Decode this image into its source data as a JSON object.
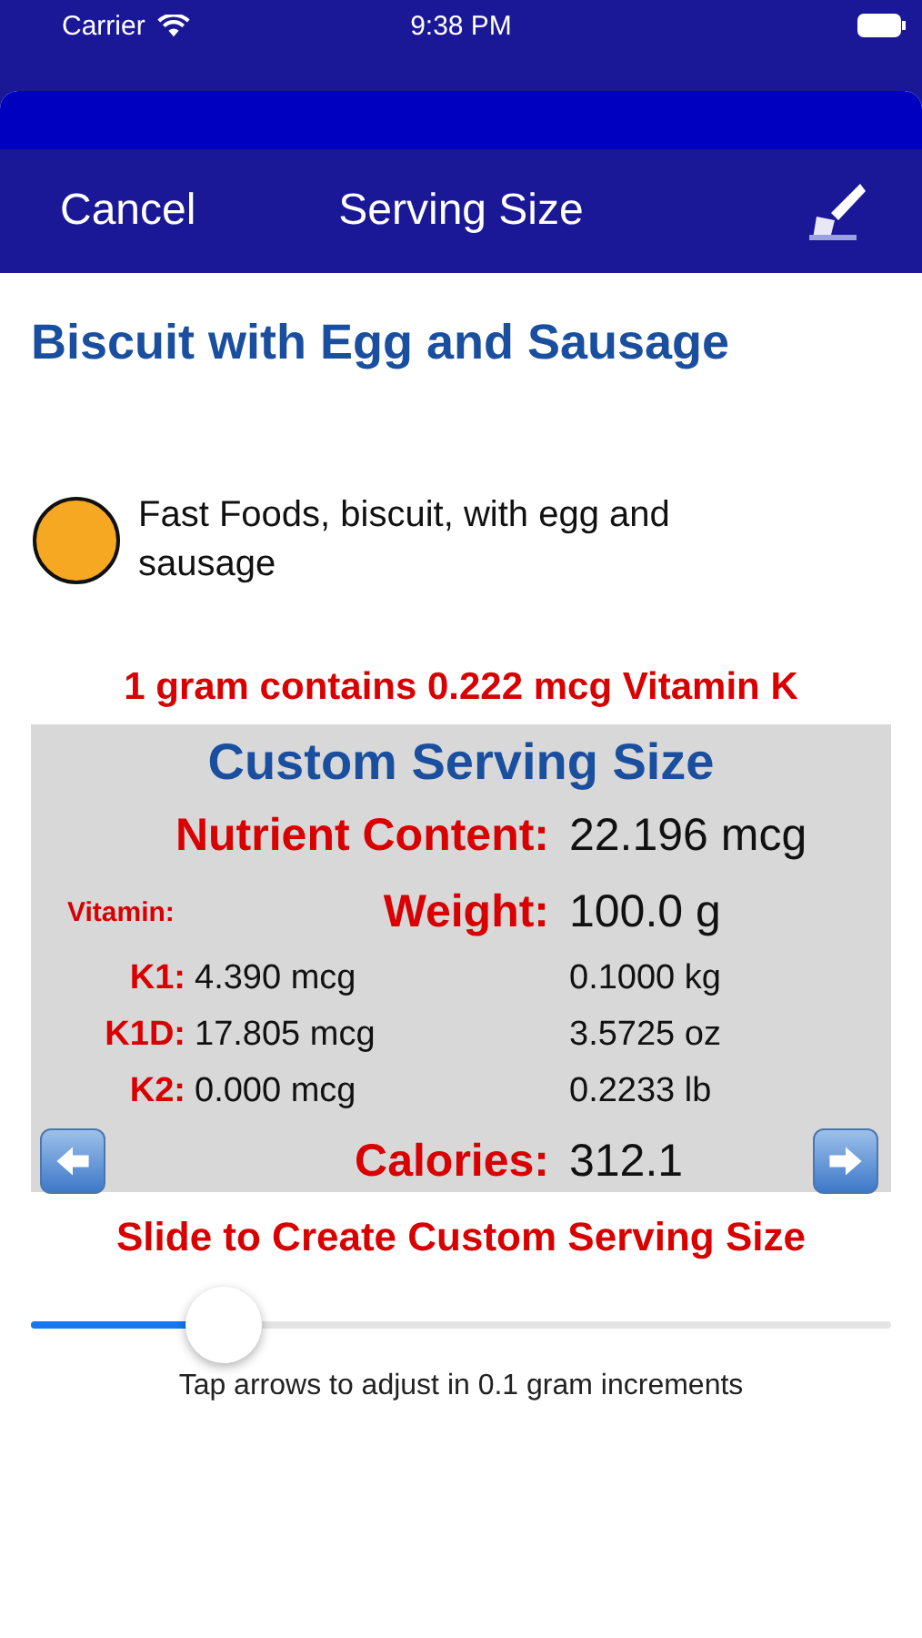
{
  "status_bar": {
    "carrier": "Carrier",
    "time": "9:38 PM"
  },
  "nav": {
    "cancel": "Cancel",
    "title": "Serving Size"
  },
  "food": {
    "name": "Biscuit with Egg and Sausage",
    "category": "Fast Foods, biscuit, with egg and sausage",
    "color": "#f7a823"
  },
  "per_gram": "1 gram contains 0.222 mcg Vitamin K",
  "custom": {
    "title": "Custom Serving Size",
    "nutrient_label": "Nutrient Content:",
    "nutrient_value": "22.196 mcg",
    "vitamin_label": "Vitamin:",
    "weight_label": "Weight:",
    "weight_value": "100.0 g",
    "vitamins": [
      {
        "label": "K1:",
        "value": "4.390 mcg",
        "weight": "0.1000 kg"
      },
      {
        "label": "K1D:",
        "value": "17.805 mcg",
        "weight": "3.5725 oz"
      },
      {
        "label": "K2:",
        "value": "0.000 mcg",
        "weight": "0.2233 lb"
      }
    ],
    "calories_label": "Calories:",
    "calories_value": "312.1"
  },
  "slider": {
    "title": "Slide to Create Custom Serving Size",
    "level": 0.225,
    "hint": "Tap arrows to adjust in 0.1 gram increments"
  }
}
